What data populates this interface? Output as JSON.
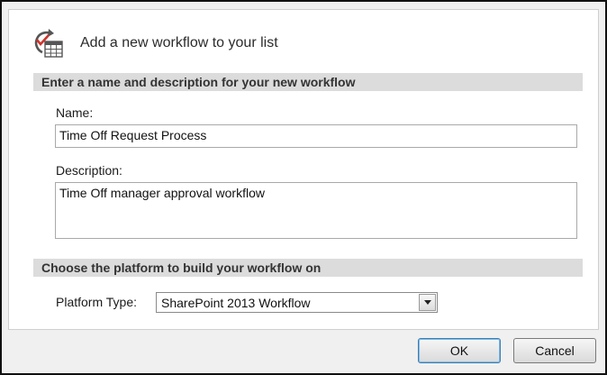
{
  "dialog": {
    "title": "Add a new workflow to your list",
    "icon": "workflow-calendar-icon",
    "section_name": {
      "header": "Enter a name and description for your new workflow",
      "name_label": "Name:",
      "name_value": "Time Off Request Process",
      "description_label": "Description:",
      "description_value": "Time Off manager approval workflow"
    },
    "section_platform": {
      "header": "Choose the platform to build your workflow on",
      "platform_label": "Platform Type:",
      "platform_value": "SharePoint 2013 Workflow"
    },
    "buttons": {
      "ok_label": "OK",
      "cancel_label": "Cancel"
    }
  },
  "colors": {
    "section_header_bg": "#dcdcdc",
    "icon_red": "#d0322a",
    "icon_gray": "#555555"
  }
}
